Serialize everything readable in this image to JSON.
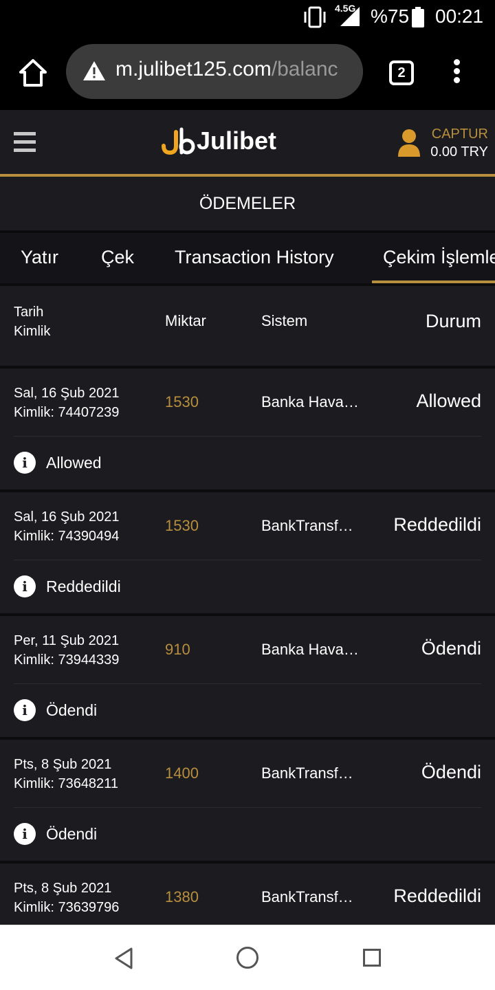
{
  "status_bar": {
    "network": "4.5G",
    "battery": "%75",
    "time": "00:21"
  },
  "browser": {
    "url_main": "m.julibet125.com",
    "url_path": "/balanc",
    "tab_count": "2"
  },
  "site": {
    "logo": "Julibet",
    "user_name": "CAPTUR",
    "balance": "0.00 TRY",
    "accent_color": "#b88f3d"
  },
  "page_title": "ÖDEMELER",
  "tabs": [
    {
      "label": "Yatır"
    },
    {
      "label": "Çek"
    },
    {
      "label": "Transaction History"
    },
    {
      "label": "Çekim İşlemleri"
    }
  ],
  "table": {
    "headers": {
      "date": "Tarih",
      "id": "Kimlik",
      "amount": "Miktar",
      "system": "Sistem",
      "status": "Durum"
    },
    "rows": [
      {
        "date": "Sal, 16 Şub 2021",
        "id": "Kimlik: 74407239",
        "amount": "1530",
        "system": "Banka Hava…",
        "status": "Allowed",
        "note": "Allowed"
      },
      {
        "date": "Sal, 16 Şub 2021",
        "id": "Kimlik: 74390494",
        "amount": "1530",
        "system": "BankTransf…",
        "status": "Reddedildi",
        "note": "Reddedildi"
      },
      {
        "date": "Per, 11 Şub 2021",
        "id": "Kimlik: 73944339",
        "amount": "910",
        "system": "Banka Hava…",
        "status": "Ödendi",
        "note": "Ödendi"
      },
      {
        "date": "Pts, 8 Şub 2021",
        "id": "Kimlik: 73648211",
        "amount": "1400",
        "system": "BankTransf…",
        "status": "Ödendi",
        "note": "Ödendi"
      },
      {
        "date": "Pts, 8 Şub 2021",
        "id": "Kimlik: 73639796",
        "amount": "1380",
        "system": "BankTransf…",
        "status": "Reddedildi",
        "note": ""
      }
    ]
  }
}
